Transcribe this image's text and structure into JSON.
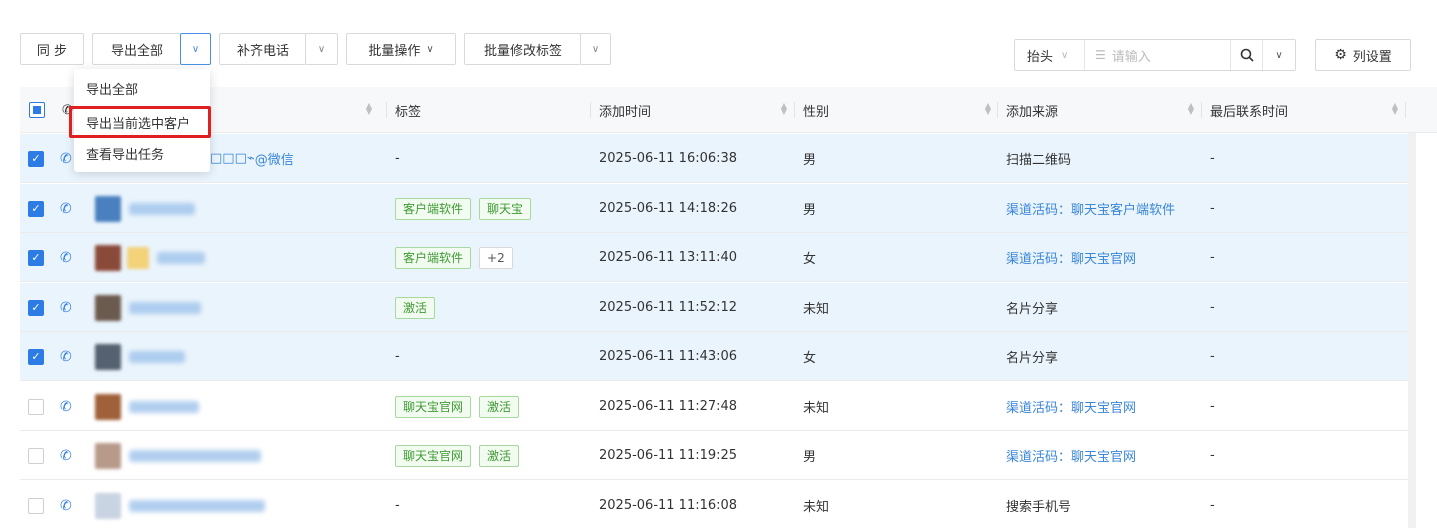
{
  "toolbar": {
    "sync": "同 步",
    "export_all": "导出全部",
    "fill_phone": "补齐电话",
    "batch_ops": "批量操作",
    "batch_edit_tags": "批量修改标签",
    "column_settings": "列设置"
  },
  "search": {
    "field": "抬头",
    "placeholder": "请输入"
  },
  "export_menu": {
    "items": [
      "导出全部",
      "导出当前选中客户",
      "查看导出任务"
    ]
  },
  "table": {
    "headers": {
      "tags": "标签",
      "added_time": "添加时间",
      "gender": "性别",
      "source": "添加来源",
      "last_contact": "最后联系时间"
    },
    "rows": [
      {
        "selected": true,
        "name_visible": "@微信",
        "tags": [],
        "tags_text": "-",
        "time": "2025-06-11 16:06:38",
        "gender": "男",
        "source": "扫描二维码",
        "source_link": false,
        "last": "-"
      },
      {
        "selected": true,
        "tags": [
          "客户端软件",
          "聊天宝"
        ],
        "time": "2025-06-11 14:18:26",
        "gender": "男",
        "source": "渠道活码：聊天宝客户端软件",
        "source_link": true,
        "last": "-"
      },
      {
        "selected": true,
        "tags": [
          "客户端软件",
          "+2"
        ],
        "time": "2025-06-11 13:11:40",
        "gender": "女",
        "source": "渠道活码：聊天宝官网",
        "source_link": true,
        "last": "-"
      },
      {
        "selected": true,
        "tags": [
          "激活"
        ],
        "time": "2025-06-11 11:52:12",
        "gender": "未知",
        "source": "名片分享",
        "source_link": false,
        "last": "-"
      },
      {
        "selected": true,
        "tags": [],
        "tags_text": "-",
        "time": "2025-06-11 11:43:06",
        "gender": "女",
        "source": "名片分享",
        "source_link": false,
        "last": "-"
      },
      {
        "selected": false,
        "tags": [
          "聊天宝官网",
          "激活"
        ],
        "time": "2025-06-11 11:27:48",
        "gender": "未知",
        "source": "渠道活码：聊天宝官网",
        "source_link": true,
        "last": "-"
      },
      {
        "selected": false,
        "tags": [
          "聊天宝官网",
          "激活"
        ],
        "time": "2025-06-11 11:19:25",
        "gender": "男",
        "source": "渠道活码：聊天宝官网",
        "source_link": true,
        "last": "-"
      },
      {
        "selected": false,
        "tags": [],
        "tags_text": "-",
        "time": "2025-06-11 11:16:08",
        "gender": "未知",
        "source": "搜索手机号",
        "source_link": false,
        "last": "-"
      }
    ]
  },
  "colors": {
    "primary": "#2d7be5",
    "selected_row": "#eaf4fc",
    "tag_green": "#3f9a36",
    "highlight_red": "#e02020"
  }
}
